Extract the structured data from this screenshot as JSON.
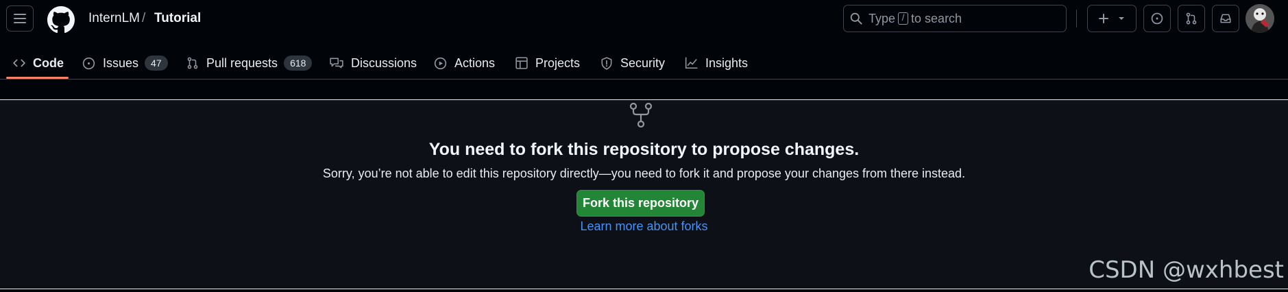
{
  "header": {
    "owner": "InternLM",
    "separator": "/",
    "repo": "Tutorial",
    "search": {
      "prefix": "Type",
      "key": "/",
      "suffix": "to search"
    }
  },
  "tabs": [
    {
      "label": "Code",
      "icon": "code-icon",
      "active": true
    },
    {
      "label": "Issues",
      "icon": "issue-opened-icon",
      "count": "47"
    },
    {
      "label": "Pull requests",
      "icon": "git-pull-request-icon",
      "count": "618"
    },
    {
      "label": "Discussions",
      "icon": "comment-discussion-icon"
    },
    {
      "label": "Actions",
      "icon": "play-icon"
    },
    {
      "label": "Projects",
      "icon": "table-icon"
    },
    {
      "label": "Security",
      "icon": "shield-icon"
    },
    {
      "label": "Insights",
      "icon": "graph-icon"
    }
  ],
  "main": {
    "icon": "repo-forked-icon",
    "heading": "You need to fork this repository to propose changes.",
    "description": "Sorry, you’re not able to edit this repository directly—you need to fork it and propose your changes from there instead.",
    "fork_button": "Fork this repository",
    "learn_more": "Learn more about forks"
  },
  "watermark": "CSDN @wxhbest",
  "colors": {
    "page_bg": "#010409",
    "main_bg": "#0d1117",
    "accent_underline": "#f78166",
    "primary_button": "#238636",
    "link": "#4493f8"
  }
}
